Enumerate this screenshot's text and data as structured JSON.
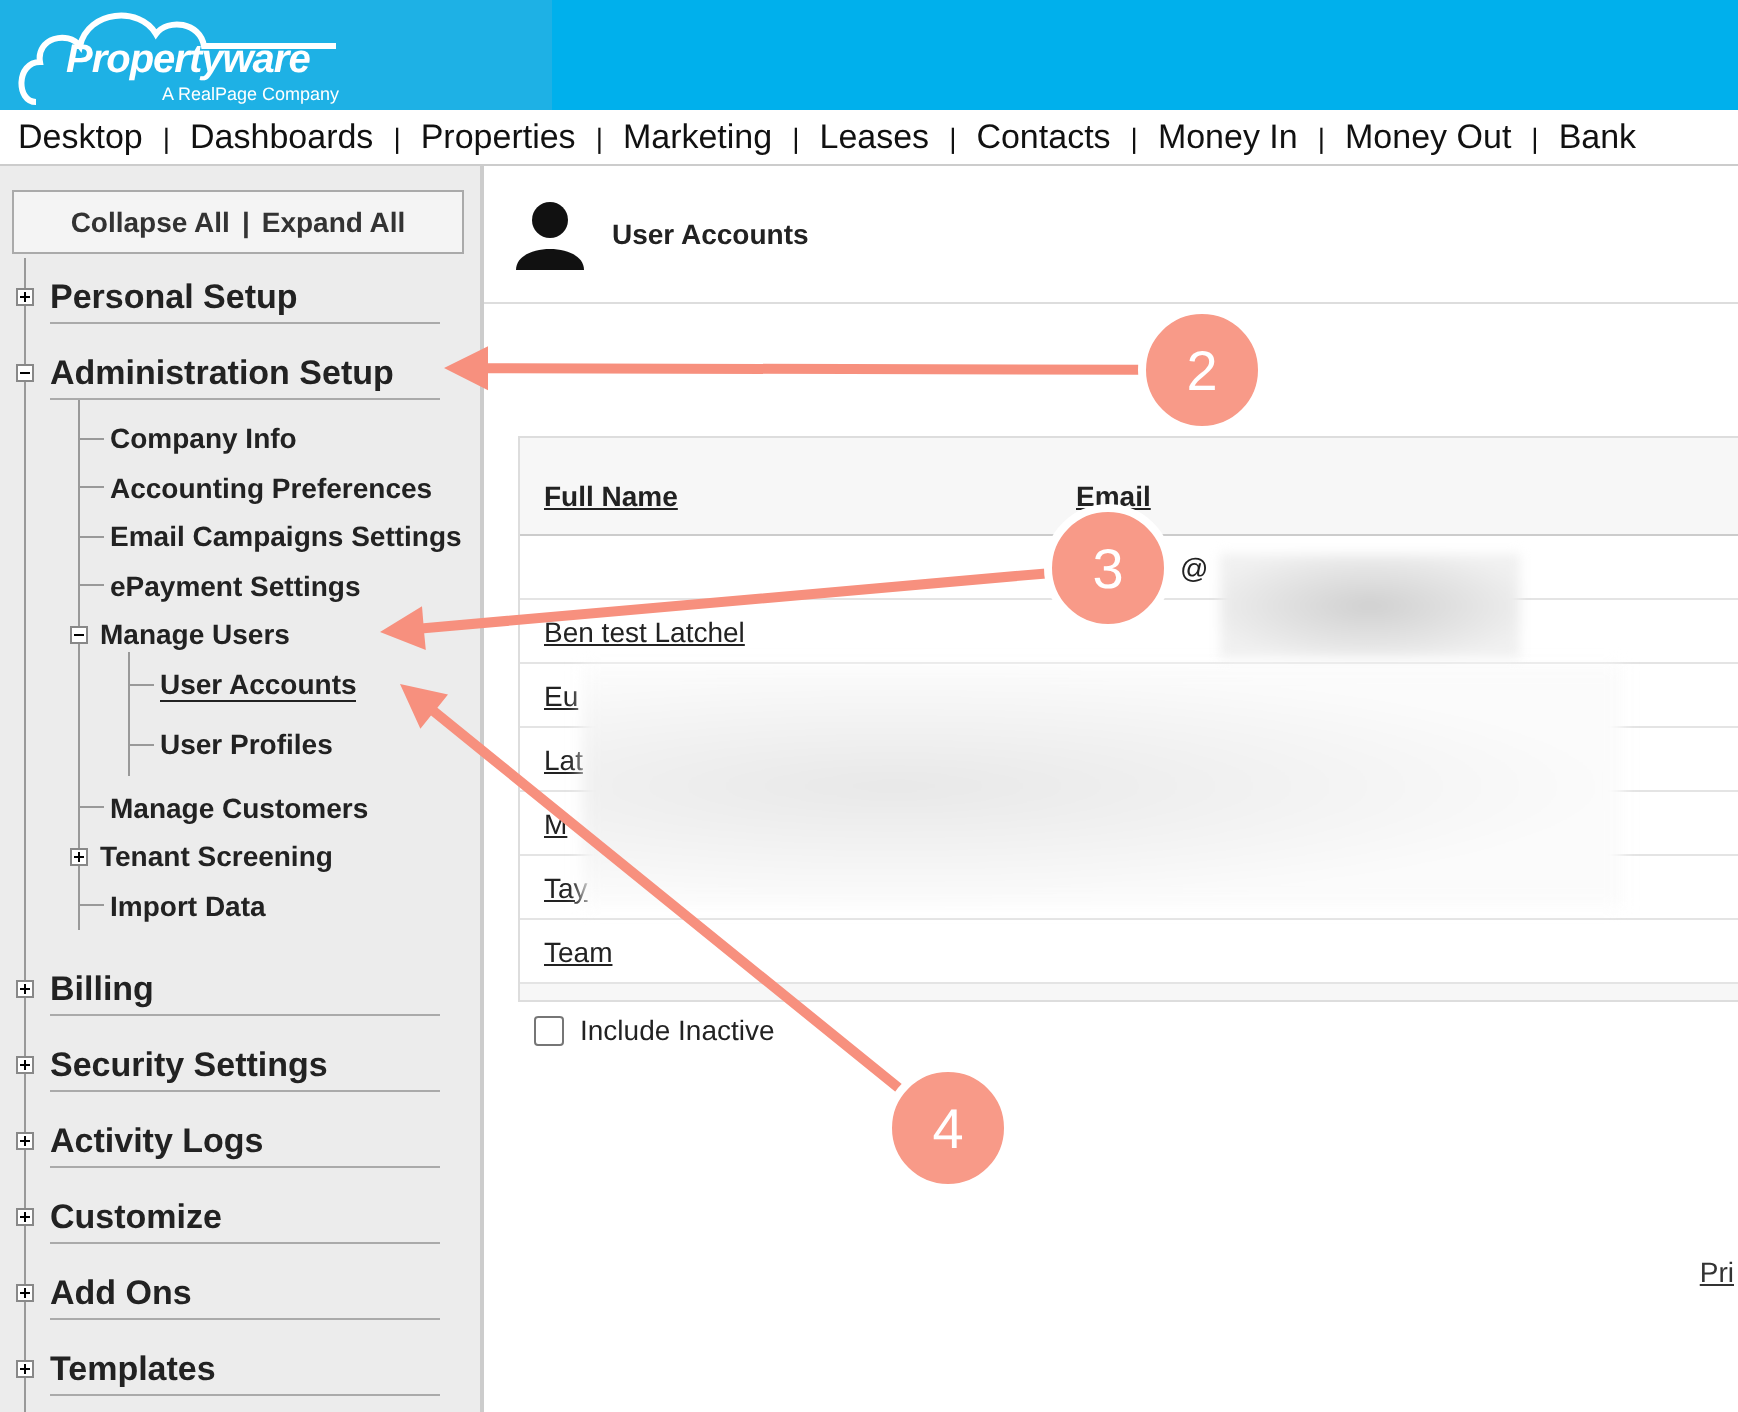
{
  "header": {
    "logo_name": "Propertyware",
    "logo_tagline": "A RealPage Company"
  },
  "nav": [
    {
      "label": "Desktop",
      "separator": "|"
    },
    {
      "label": "Dashboards",
      "separator": "|"
    },
    {
      "label": "Properties",
      "separator": "|"
    },
    {
      "label": "Marketing",
      "separator": "|"
    },
    {
      "label": "Leases",
      "separator": "|"
    },
    {
      "label": "Contacts",
      "separator": "|"
    },
    {
      "label": "Money In",
      "separator": "|"
    },
    {
      "label": "Money Out",
      "separator": "|"
    },
    {
      "label": "Bank"
    }
  ],
  "sidebar": {
    "collapse_all": "Collapse All",
    "separator": "|",
    "expand_all": "Expand All",
    "sections": [
      {
        "label": "Personal Setup",
        "expanded": false
      },
      {
        "label": "Administration Setup",
        "expanded": true,
        "children": [
          {
            "label": "Company Info"
          },
          {
            "label": "Accounting Preferences"
          },
          {
            "label": "Email Campaigns Settings"
          },
          {
            "label": "ePayment Settings"
          },
          {
            "label": "Manage Users",
            "expanded": true,
            "children": [
              {
                "label": "User Accounts",
                "selected": true
              },
              {
                "label": "User Profiles",
                "selected": false
              }
            ]
          },
          {
            "label": "Manage Customers"
          },
          {
            "label": "Tenant Screening",
            "expanded": false
          },
          {
            "label": "Import Data"
          }
        ]
      },
      {
        "label": "Billing",
        "expanded": false
      },
      {
        "label": "Security Settings",
        "expanded": false
      },
      {
        "label": "Activity Logs",
        "expanded": false
      },
      {
        "label": "Customize",
        "expanded": false
      },
      {
        "label": "Add Ons",
        "expanded": false
      },
      {
        "label": "Templates",
        "expanded": false
      }
    ]
  },
  "page": {
    "title": "User Accounts"
  },
  "table": {
    "columns": [
      "Full Name",
      "Email"
    ],
    "rows": [
      {
        "email": "@"
      },
      {
        "name": "Ben test Latchel"
      },
      {
        "name": "Eu"
      },
      {
        "name": "Lat"
      },
      {
        "name": "M"
      },
      {
        "name": "Tay"
      },
      {
        "name": "Team"
      }
    ]
  },
  "include_inactive": {
    "label": "Include Inactive",
    "checked": false
  },
  "footer": {
    "link": "Pri"
  },
  "annotations": [
    {
      "label": "2"
    },
    {
      "label": "3"
    },
    {
      "label": "4"
    }
  ]
}
